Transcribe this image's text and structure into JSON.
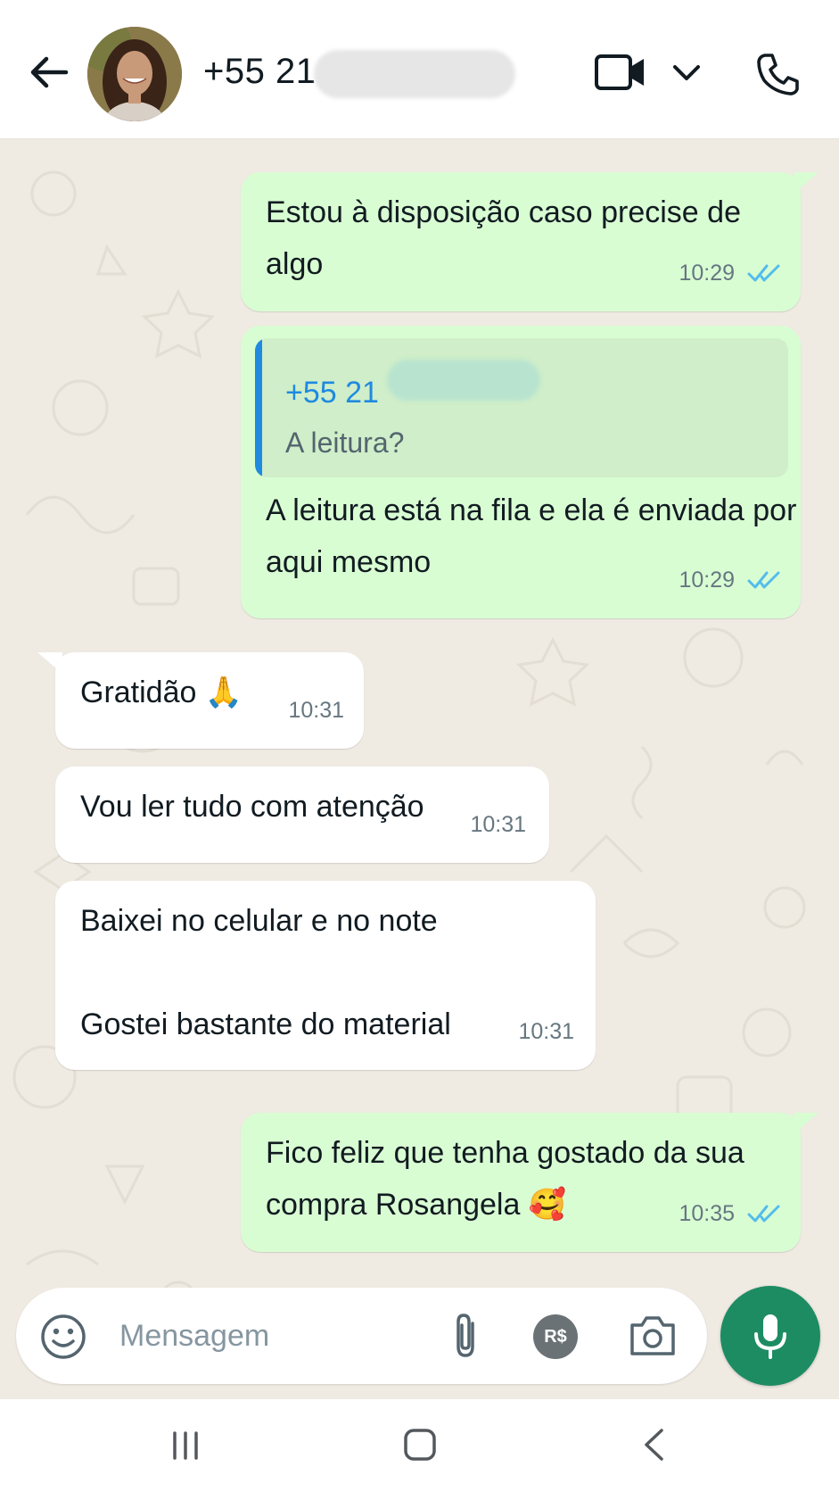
{
  "header": {
    "contact_name": "+55 21",
    "icons": [
      "back-arrow-icon",
      "video-call-icon",
      "chevron-down-icon",
      "phone-icon"
    ]
  },
  "messages": [
    {
      "direction": "out",
      "text": "Estou à disposição caso precise de\nalgo",
      "time": "10:29",
      "status": "read"
    },
    {
      "direction": "out",
      "quote_name": "+55 21",
      "quote_text": "A leitura?",
      "text": "A leitura está na fila e ela é enviada por\naqui mesmo",
      "time": "10:29",
      "status": "read"
    },
    {
      "direction": "in",
      "text": "Gratidão",
      "emoji": "🙏",
      "time": "10:31"
    },
    {
      "direction": "in",
      "text": "Vou ler tudo com atenção",
      "time": "10:31"
    },
    {
      "direction": "in",
      "text": "Baixei no celular e no note\n\nGostei bastante do material",
      "time": "10:31"
    },
    {
      "direction": "out",
      "text": "Fico feliz que tenha gostado da sua\ncompra Rosangela",
      "emoji": "🥰",
      "time": "10:35",
      "status": "read"
    }
  ],
  "composer": {
    "placeholder": "Mensagem",
    "pay_label": "R$"
  },
  "colors": {
    "outgoing_bubble": "#d9fdd3",
    "incoming_bubble": "#ffffff",
    "chat_background": "#efeae2",
    "read_ticks": "#53bdeb",
    "mic_button": "#1d8c62",
    "quote_accent": "#1f8ae0"
  }
}
